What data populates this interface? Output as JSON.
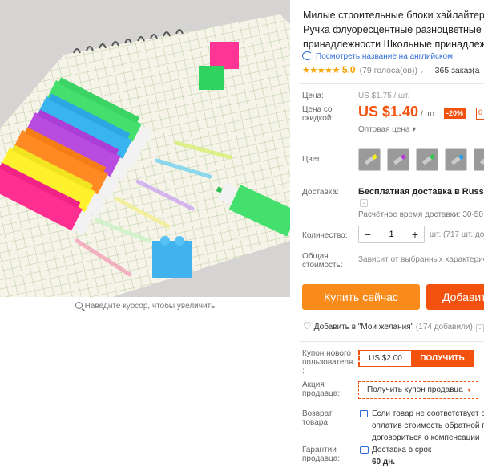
{
  "product": {
    "title_lines": [
      "Милые строительные блоки хайлайтер",
      "Ручка флуоресцентные разноцветные м",
      "принадлежности Школьные принадлеж"
    ],
    "translate_link": "Посмотреть название на английском",
    "rating": {
      "stars": "★★★★★",
      "value": "5.0",
      "votes": "(79 голоса(ов))",
      "caret": "⌄"
    },
    "orders": "365 заказ(а"
  },
  "gallery": {
    "zoom_hint": "Наведите курсор, чтобы увеличить",
    "icon": "magnifier-icon"
  },
  "price": {
    "label_price": "Цена:",
    "old": "US $1.75 / шт.",
    "label_discount_price": [
      "Цена со",
      "скидкой:"
    ],
    "current": "US $1.40",
    "unit": "/ шт.",
    "discount": "-20%",
    "promo_badge": "0",
    "wholesale": "Оптовая цена ▾"
  },
  "color": {
    "label": "Цвет:",
    "swatches": [
      {
        "name": "yellow",
        "accent": "#f5ee1c"
      },
      {
        "name": "purple",
        "accent": "#b43fd6"
      },
      {
        "name": "green",
        "accent": "#35c84a"
      },
      {
        "name": "blue",
        "accent": "#2aa0e8"
      },
      {
        "name": "orange",
        "accent": "#ff8a1d"
      }
    ]
  },
  "shipping": {
    "label": "Доставка:",
    "method": "Бесплатная доставка в Russian",
    "caret": "⌄",
    "time": "Расчётное время доставки: 30-50"
  },
  "quantity": {
    "label": "Количество:",
    "minus": "−",
    "value": "1",
    "plus": "+",
    "stock": "шт. (717 шт. доступн"
  },
  "total": {
    "label": [
      "Общая",
      "стоимость:"
    ],
    "note": "Зависит от выбранных характеристи"
  },
  "actions": {
    "buy_now": "Купить сейчас",
    "add_to_cart": "Добавить",
    "wishlist": "Добавить в \"Мои желания\"",
    "wishlist_count": "(174 добавили)",
    "wishlist_caret": "⌄"
  },
  "coupons": {
    "new_user_label": [
      "Купон нового",
      "пользователя",
      ":"
    ],
    "new_user_value": "US $2.00",
    "new_user_button": "ПОЛУЧИТЬ",
    "seller_label": [
      "Акция",
      "продавца:"
    ],
    "seller_button": "Получить купон продавца",
    "seller_caret": "▼"
  },
  "returns": {
    "label": [
      "Возврат",
      "товара"
    ],
    "text": [
      "Если товар не соответствует о",
      "оплатив стоимость обратной п",
      "договориться о компенсации"
    ]
  },
  "guarantee": {
    "label": [
      "Гарантии",
      "продавца:"
    ],
    "text": "Доставка в срок",
    "days": "60 дн."
  },
  "colors": {
    "accent": "#f2520d",
    "buy": "#f98b1b",
    "link": "#2f6bd6",
    "star": "#f4a400"
  }
}
